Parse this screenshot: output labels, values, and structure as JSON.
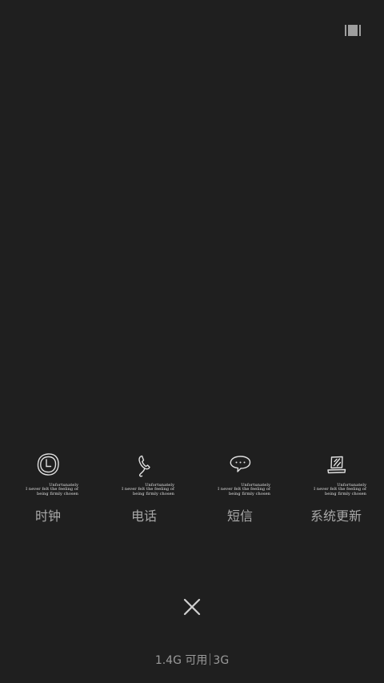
{
  "top_bar": {
    "icon": "panel-switch-icon"
  },
  "apps": [
    {
      "label": "时钟",
      "icon": "clock-icon",
      "caption": "Unfortunately\nI never felt the feeling of\nbeing firmly chosen"
    },
    {
      "label": "电话",
      "icon": "phone-icon",
      "caption": "Unfortunately\nI never felt the feeling of\nbeing firmly chosen"
    },
    {
      "label": "短信",
      "icon": "message-icon",
      "caption": "Unfortunately\nI never felt the feeling of\nbeing firmly chosen"
    },
    {
      "label": "系统更新",
      "icon": "system-update-icon",
      "caption": "Unfortunately\nI never felt the feeling of\nbeing firmly chosen"
    }
  ],
  "close": {
    "icon": "close-icon"
  },
  "status": {
    "memory": "1.4G 可用",
    "network": "3G"
  },
  "colors": {
    "background": "#1f1f1f",
    "icon_stroke": "#e0e0e0",
    "label_text": "#a8a8a8"
  }
}
